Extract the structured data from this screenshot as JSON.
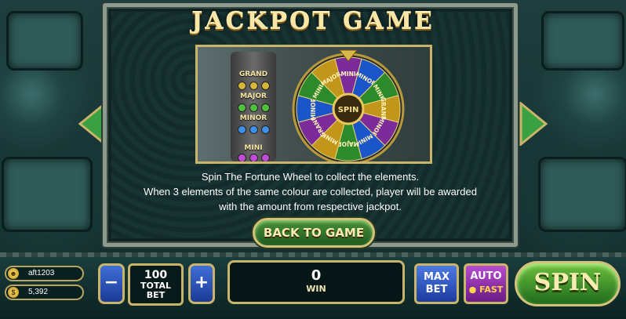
{
  "title": "JACKPOT GAME",
  "jackpot_levels": {
    "grand": "GRAND",
    "major": "MAJOR",
    "minor": "MINOR",
    "mini": "MINI"
  },
  "wheel": {
    "center": "SPIN",
    "segments": [
      "MINI",
      "MINOR",
      "MINI",
      "GRAND",
      "MINOR",
      "MINI",
      "MAJOR",
      "MINI",
      "GRAND",
      "MINOR",
      "MINI",
      "MAJOR"
    ]
  },
  "description": {
    "line1": "Spin The Fortune Wheel to collect the elements.",
    "line2": "When 3 elements of the same colour are collected, player will be awarded",
    "line3": "with the amount from respective jackpot."
  },
  "back_button": "BACK TO GAME",
  "account": {
    "username": "aft1203",
    "balance": "5,392"
  },
  "bet": {
    "value": "100",
    "label1": "TOTAL",
    "label2": "BET",
    "minus": "−",
    "plus": "+"
  },
  "win": {
    "value": "0",
    "label": "WIN"
  },
  "buttons": {
    "max": "MAX",
    "bet": "BET",
    "auto": "AUTO",
    "fast": "FAST",
    "spin": "SPIN"
  },
  "colors": {
    "gold": "#c9b56a",
    "green": "#4a8f3a",
    "blue": "#3f6fd8",
    "purple": "#b74bd1",
    "segment_colors": [
      "#7c2b9a",
      "#1a56c9",
      "#2d8a2b",
      "#c2961a"
    ]
  },
  "icons": {
    "user": "user-icon",
    "coin": "coin-icon",
    "left": "arrow-left-icon",
    "right": "arrow-right-icon"
  }
}
